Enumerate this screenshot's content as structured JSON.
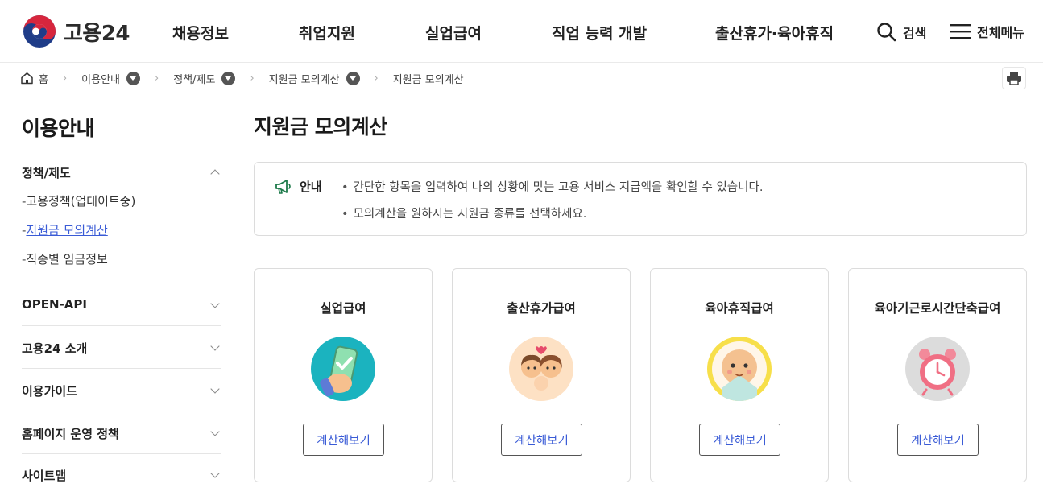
{
  "header": {
    "logo_text": "고용24",
    "nav": [
      "채용정보",
      "취업지원",
      "실업급여",
      "직업 능력 개발",
      "출산휴가·육아휴직"
    ],
    "search_label": "검색",
    "menu_label": "전체메뉴"
  },
  "breadcrumb": {
    "home": "홈",
    "items": [
      "이용안내",
      "정책/제도",
      "지원금 모의계산",
      "지원금 모의계산"
    ]
  },
  "sidebar": {
    "title": "이용안내",
    "groups": [
      {
        "label": "정책/제도",
        "expanded": true,
        "items": [
          "고용정책(업데이트중)",
          "지원금 모의계산",
          "직종별 임금정보"
        ],
        "active_index": 1
      },
      {
        "label": "OPEN-API"
      },
      {
        "label": "고용24 소개"
      },
      {
        "label": "이용가이드"
      },
      {
        "label": "홈페이지 운영 정책"
      },
      {
        "label": "사이트맵"
      }
    ]
  },
  "main": {
    "title": "지원금 모의계산",
    "notice": {
      "label": "안내",
      "lines": [
        "간단한 항목을 입력하여 나의 상황에 맞는 고용 서비스 지급액을 확인할 수 있습니다.",
        "모의계산을 원하시는 지원금 종류를 선택하세요."
      ]
    },
    "cards": [
      {
        "title": "실업급여",
        "button": "계산해보기",
        "icon": "phone-check-icon",
        "bg": "#1bb3bf"
      },
      {
        "title": "출산휴가급여",
        "button": "계산해보기",
        "icon": "parents-baby-icon",
        "bg": "#fde1c4"
      },
      {
        "title": "육아휴직급여",
        "button": "계산해보기",
        "icon": "baby-face-icon",
        "bg": "#f7df4a"
      },
      {
        "title": "육아기근로시간단축급여",
        "button": "계산해보기",
        "icon": "alarm-clock-icon",
        "bg": "#dcdcdc"
      }
    ]
  },
  "colors": {
    "accent": "#3a5bd6",
    "logo_red": "#d7263d",
    "logo_blue": "#1f3c88"
  }
}
